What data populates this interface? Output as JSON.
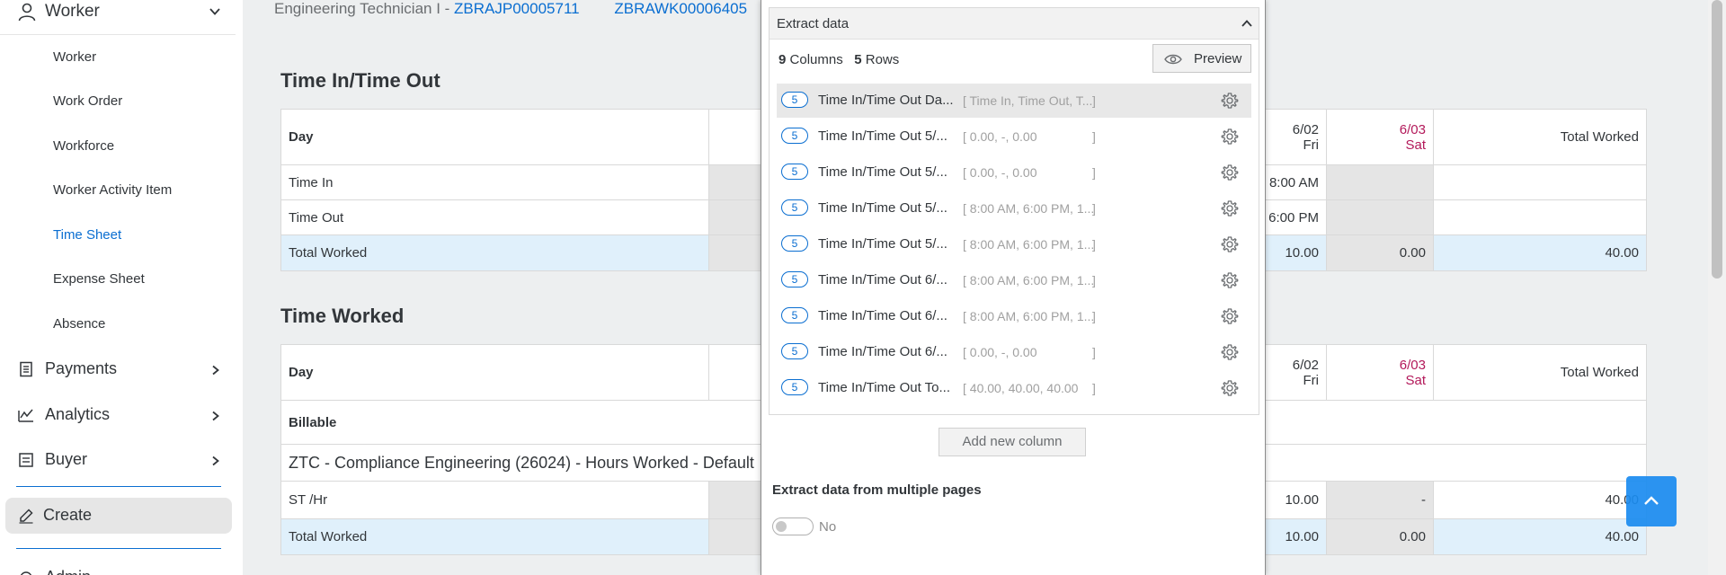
{
  "sidebar": {
    "header": {
      "label": "Worker"
    },
    "items": [
      {
        "label": "Worker"
      },
      {
        "label": "Work Order"
      },
      {
        "label": "Workforce"
      },
      {
        "label": "Worker Activity Item"
      },
      {
        "label": "Time Sheet",
        "active": true
      },
      {
        "label": "Expense Sheet"
      },
      {
        "label": "Absence"
      }
    ],
    "groups": {
      "payments": "Payments",
      "analytics": "Analytics",
      "buyer": "Buyer",
      "create": "Create",
      "admin": "Admin"
    }
  },
  "breadcrumb": {
    "role": "Engineering Technician I - ",
    "job_posting": "ZBRAJP00005711",
    "work_order": "ZBRAWK00006405"
  },
  "time_in_out": {
    "title": "Time In/Time Out",
    "header": {
      "day": "Day",
      "d602_date": "6/02",
      "d602_day": "Fri",
      "d603_date": "6/03",
      "d603_day": "Sat",
      "total": "Total Worked"
    },
    "rows": {
      "time_in": {
        "label": "Time In",
        "d602": "8:00 AM"
      },
      "time_out": {
        "label": "Time Out",
        "d602": "6:00 PM"
      },
      "total": {
        "label": "Total Worked",
        "d602": "10.00",
        "d603": "0.00",
        "total": "40.00"
      }
    }
  },
  "time_worked": {
    "title": "Time Worked",
    "header": {
      "day": "Day",
      "d602_date": "6/02",
      "d602_day": "Fri",
      "d603_date": "6/03",
      "d603_day": "Sat",
      "total": "Total Worked"
    },
    "billable": "Billable",
    "project": "ZTC - Compliance Engineering (26024) - Hours Worked - Default",
    "rows": {
      "st_hr": {
        "label": "ST /Hr",
        "d602": "10.00",
        "d603": "-",
        "total": "40.00"
      },
      "total": {
        "label": "Total Worked",
        "d602": "10.00",
        "d603": "0.00",
        "total": "40.00"
      }
    }
  },
  "extract_panel": {
    "title": "Extract data",
    "columns_count": "9",
    "columns_label": "Columns",
    "rows_count": "5",
    "rows_label": "Rows",
    "preview_label": "Preview",
    "columns": [
      {
        "count": "5",
        "name": "Time In/Time Out Da...",
        "values": "[ Time In, Time Out, T...",
        "close": "]"
      },
      {
        "count": "5",
        "name": "Time In/Time Out 5/...",
        "values": "[ 0.00, -, 0.00",
        "close": "]"
      },
      {
        "count": "5",
        "name": "Time In/Time Out 5/...",
        "values": "[ 0.00, -, 0.00",
        "close": "]"
      },
      {
        "count": "5",
        "name": "Time In/Time Out 5/...",
        "values": "[ 8:00 AM, 6:00 PM, 1...",
        "close": "]"
      },
      {
        "count": "5",
        "name": "Time In/Time Out 5/...",
        "values": "[ 8:00 AM, 6:00 PM, 1...",
        "close": "]"
      },
      {
        "count": "5",
        "name": "Time In/Time Out 6/...",
        "values": "[ 8:00 AM, 6:00 PM, 1...",
        "close": "]"
      },
      {
        "count": "5",
        "name": "Time In/Time Out 6/...",
        "values": "[ 8:00 AM, 6:00 PM, 1...",
        "close": "]"
      },
      {
        "count": "5",
        "name": "Time In/Time Out 6/...",
        "values": "[ 0.00, -, 0.00",
        "close": "]"
      },
      {
        "count": "5",
        "name": "Time In/Time Out To...",
        "values": "[ 40.00, 40.00, 40.00",
        "close": "]"
      }
    ],
    "add_column_label": "Add new column",
    "multi_pages_title": "Extract data from multiple pages",
    "multi_pages_value": "No"
  },
  "colors": {
    "accent": "#0a6ed1",
    "weekend": "#b3195a",
    "highlight_row": "#e0f0fb"
  }
}
